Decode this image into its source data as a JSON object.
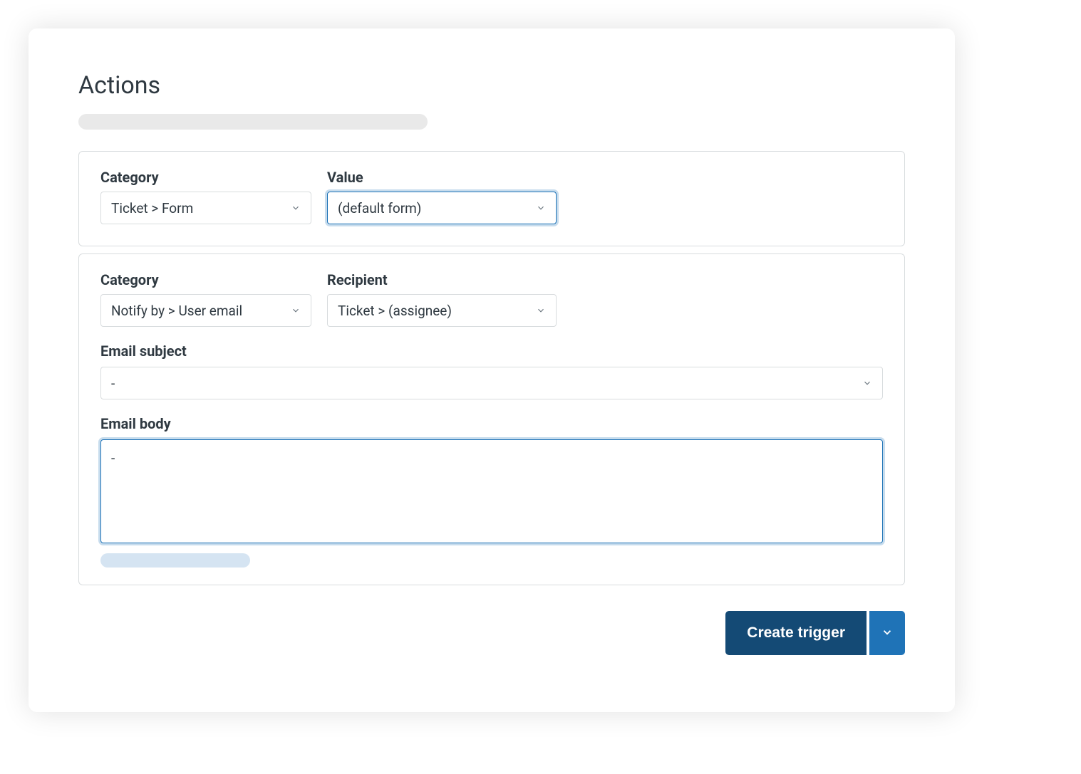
{
  "section_title": "Actions",
  "action1": {
    "category_label": "Category",
    "category_value": "Ticket > Form",
    "value_label": "Value",
    "value_value": "(default form)"
  },
  "action2": {
    "category_label": "Category",
    "category_value": "Notify by > User email",
    "recipient_label": "Recipient",
    "recipient_value": "Ticket > (assignee)",
    "subject_label": "Email subject",
    "subject_value": "-",
    "body_label": "Email body",
    "body_value": "-"
  },
  "footer": {
    "submit_label": "Create trigger"
  }
}
